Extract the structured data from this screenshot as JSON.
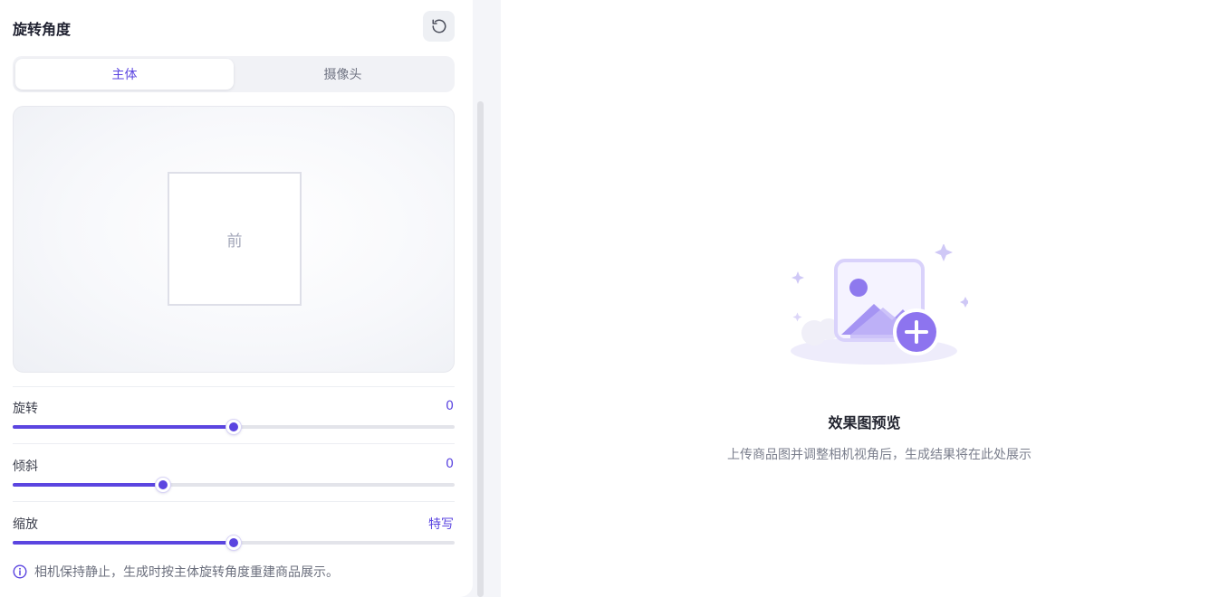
{
  "panel": {
    "title": "旋转角度",
    "reset_icon": "rotate-ccw-icon"
  },
  "tabs": [
    {
      "label": "主体",
      "active": true
    },
    {
      "label": "摄像头",
      "active": false
    }
  ],
  "stage": {
    "face_label": "前"
  },
  "sliders": {
    "rotate": {
      "label": "旋转",
      "value": "0",
      "fill_fraction": 0.5
    },
    "tilt": {
      "label": "倾斜",
      "value": "0",
      "fill_fraction": 0.34
    },
    "zoom": {
      "label": "缩放",
      "value": "特写",
      "fill_fraction": 0.5
    }
  },
  "hint": {
    "icon": "info-icon",
    "text": "相机保持静止，生成时按主体旋转角度重建商品展示。"
  },
  "preview": {
    "illustration_icon": "image-add-icon",
    "title": "效果图预览",
    "subtitle": "上传商品图并调整相机视角后，生成结果将在此处展示"
  },
  "colors": {
    "accent": "#5b45e0",
    "track": "#e3e4ea"
  }
}
